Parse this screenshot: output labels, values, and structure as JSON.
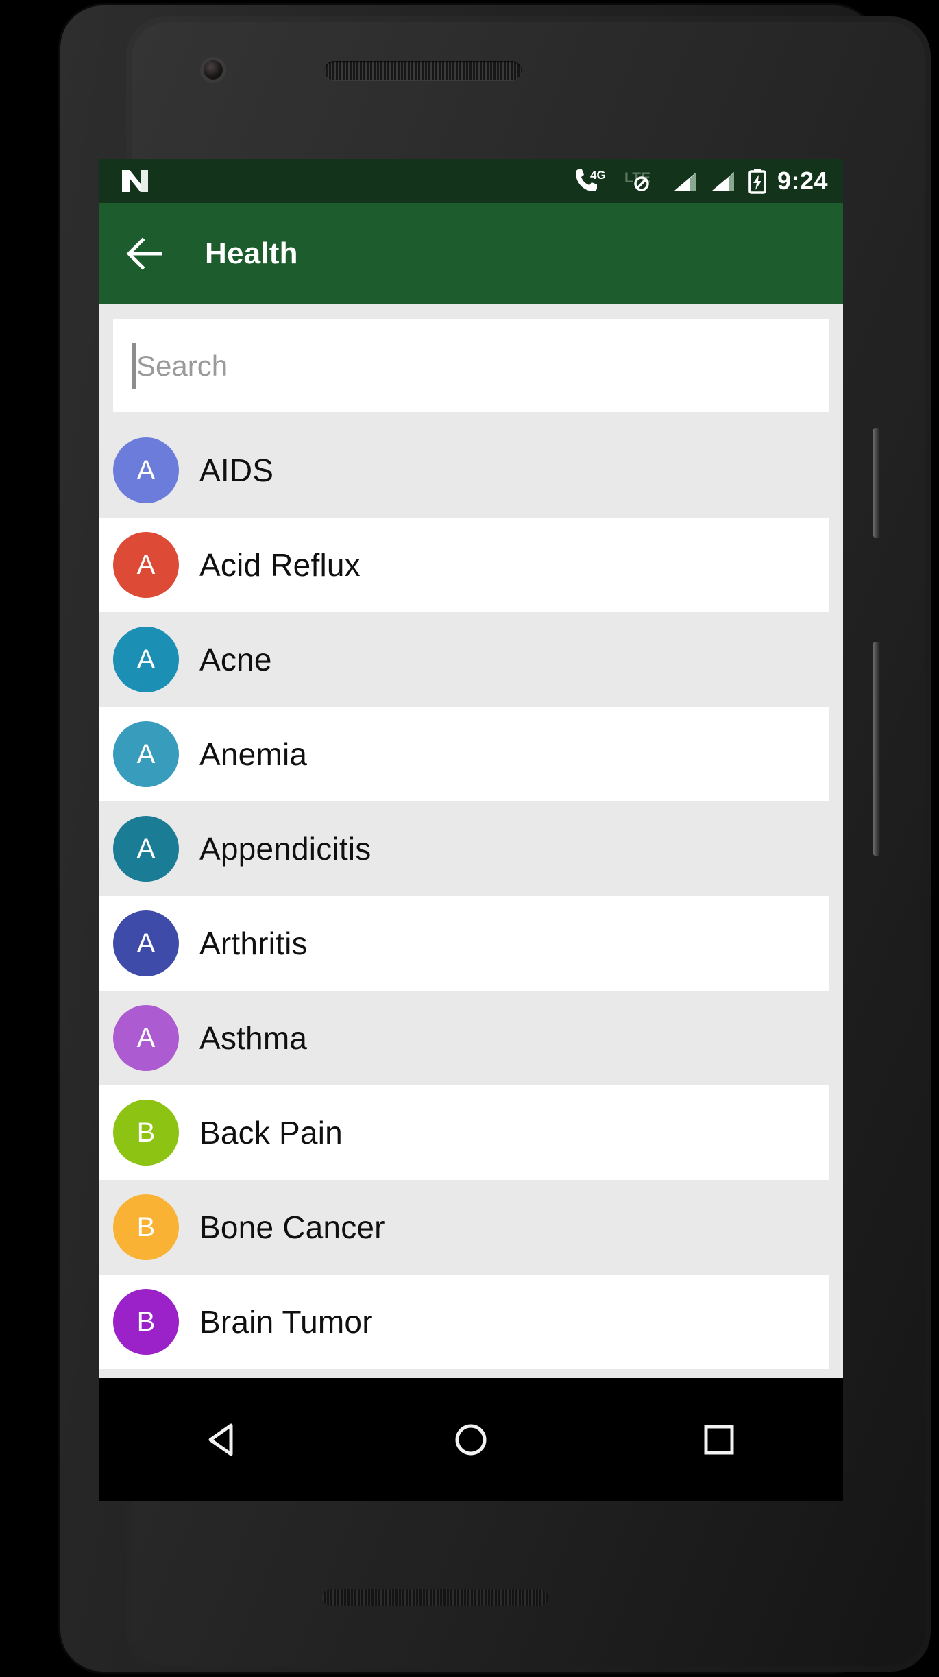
{
  "device": {
    "camera": "front-camera",
    "earpiece": "earpiece-speaker",
    "bottom_speaker": "bottom-speaker",
    "power_button": "power-button",
    "volume_rocker": "volume-rocker"
  },
  "status_bar": {
    "background": "#13331b",
    "logo": "android-nougat-logo",
    "icons": [
      {
        "name": "phone-4g-icon",
        "label": "4G"
      },
      {
        "name": "lte-disabled-icon",
        "label": "LTE"
      },
      {
        "name": "signal-bars-sim1-icon",
        "label": ""
      },
      {
        "name": "signal-bars-sim2-icon",
        "label": ""
      },
      {
        "name": "battery-charging-icon",
        "label": ""
      }
    ],
    "clock": "9:24"
  },
  "app_bar": {
    "background": "#1d5c2c",
    "back_icon": "arrow-back-icon",
    "title": "Health"
  },
  "search": {
    "placeholder": "Search",
    "value": "",
    "caret_visible": true
  },
  "list": {
    "row_bg_odd": "#e9e9e9",
    "row_bg_even": "#ffffff",
    "items": [
      {
        "initial": "A",
        "label": "AIDS",
        "color": "#6b7cdb"
      },
      {
        "initial": "A",
        "label": "Acid Reflux",
        "color": "#dd4a36"
      },
      {
        "initial": "A",
        "label": "Acne",
        "color": "#1b8fb4"
      },
      {
        "initial": "A",
        "label": "Anemia",
        "color": "#389cbd"
      },
      {
        "initial": "A",
        "label": "Appendicitis",
        "color": "#1a7d95"
      },
      {
        "initial": "A",
        "label": "Arthritis",
        "color": "#3f4ba8"
      },
      {
        "initial": "A",
        "label": "Asthma",
        "color": "#ad5bd1"
      },
      {
        "initial": "B",
        "label": "Back Pain",
        "color": "#8dc414"
      },
      {
        "initial": "B",
        "label": "Bone Cancer",
        "color": "#f9b233"
      },
      {
        "initial": "B",
        "label": "Brain Tumor",
        "color": "#9b22c9"
      }
    ]
  },
  "nav_bar": {
    "background": "#000000",
    "keys": [
      {
        "name": "nav-back-button",
        "icon": "triangle-back-icon"
      },
      {
        "name": "nav-home-button",
        "icon": "circle-home-icon"
      },
      {
        "name": "nav-recents-button",
        "icon": "square-recents-icon"
      }
    ]
  }
}
